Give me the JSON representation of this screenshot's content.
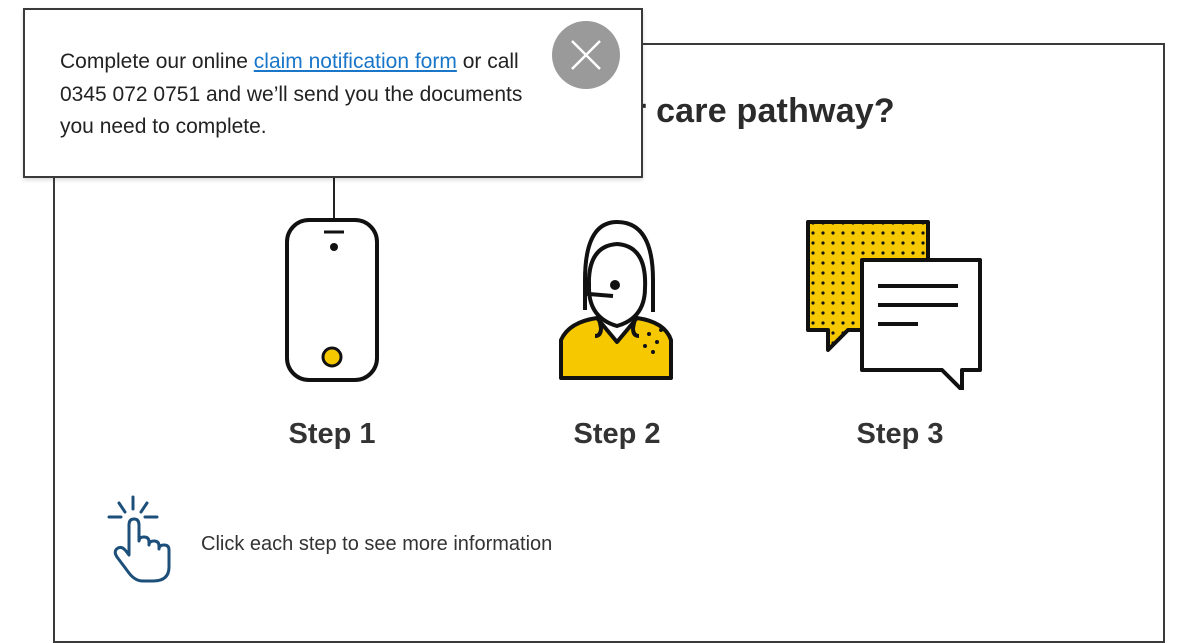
{
  "heading": "r care pathway?",
  "steps": [
    {
      "label": "Step 1",
      "icon": "phone-icon"
    },
    {
      "label": "Step 2",
      "icon": "headset-agent-icon"
    },
    {
      "label": "Step 3",
      "icon": "speech-bubbles-icon"
    }
  ],
  "hint": {
    "text": "Click each step to see more information",
    "icon": "tap-hand-icon"
  },
  "tooltip": {
    "text_before": "Complete our online ",
    "link_text": "claim notification form",
    "text_after": " or call 0345 072 0751 and we’ll send you the documents you need to complete.",
    "close_icon": "close-icon"
  },
  "colors": {
    "accent_yellow": "#f5c800",
    "link_blue": "#1976c9",
    "hint_blue": "#1c4f7a",
    "close_gray": "#9a9a9a"
  }
}
